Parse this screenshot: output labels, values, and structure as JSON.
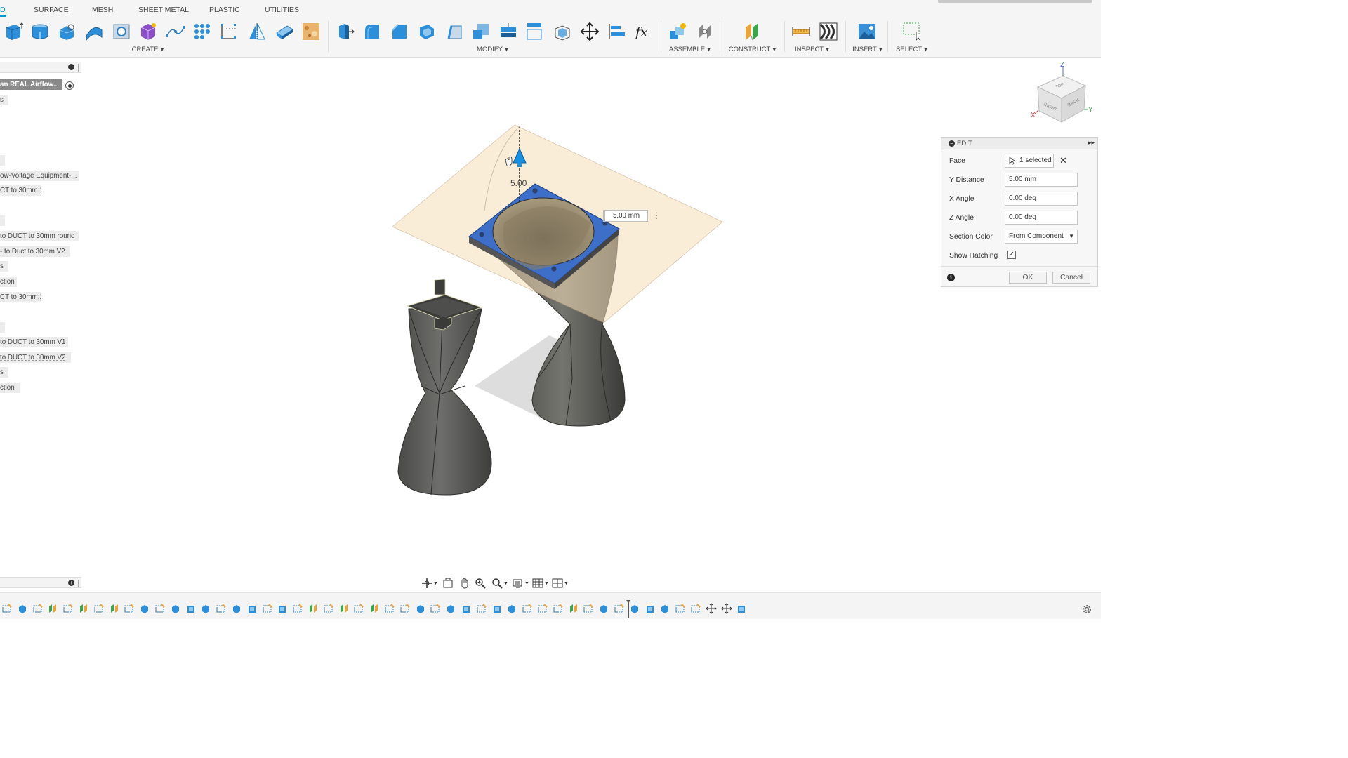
{
  "tabs": [
    {
      "label": "D",
      "active": true
    },
    {
      "label": "SURFACE"
    },
    {
      "label": "MESH"
    },
    {
      "label": "SHEET METAL"
    },
    {
      "label": "PLASTIC"
    },
    {
      "label": "UTILITIES"
    }
  ],
  "toolbar_groups": {
    "create": "CREATE",
    "modify": "MODIFY",
    "assemble": "ASSEMBLE",
    "construct": "CONSTRUCT",
    "inspect": "INSPECT",
    "insert": "INSERT",
    "select": "SELECT"
  },
  "browser": {
    "root_item": "an REAL Airflow...",
    "items": [
      "s",
      "",
      "ow-Voltage Equipment-...",
      "CT to 30mm:1",
      "",
      "to DUCT to 30mm round",
      "- to Duct to 30mm V2",
      "s",
      "ction",
      "CT to 30mm:1",
      "",
      "to DUCT to 30mm V1",
      "to DUCT to 30mm V2",
      "s",
      "ction"
    ]
  },
  "viewport": {
    "distance_input": "5.00 mm",
    "dimension_label": "5.00"
  },
  "viewcube": {
    "faces": {
      "top": "TOP",
      "right": "RIGHT",
      "back": "BACK"
    },
    "axes": {
      "x": "X",
      "y": "Y",
      "z": "Z"
    }
  },
  "edit_panel": {
    "title": "EDIT",
    "face_label": "Face",
    "face_value": "1 selected",
    "y_distance_label": "Y Distance",
    "y_distance_value": "5.00 mm",
    "x_angle_label": "X Angle",
    "x_angle_value": "0.00 deg",
    "z_angle_label": "Z Angle",
    "z_angle_value": "0.00 deg",
    "section_color_label": "Section Color",
    "section_color_value": "From Component",
    "show_hatching_label": "Show Hatching",
    "show_hatching_checked": true,
    "ok_label": "OK",
    "cancel_label": "Cancel"
  },
  "colors": {
    "accent": "#0696d7",
    "selected_face": "#3d6fc9",
    "section_plane": "#f7dfb8",
    "model_gray": "#5a5a58"
  }
}
